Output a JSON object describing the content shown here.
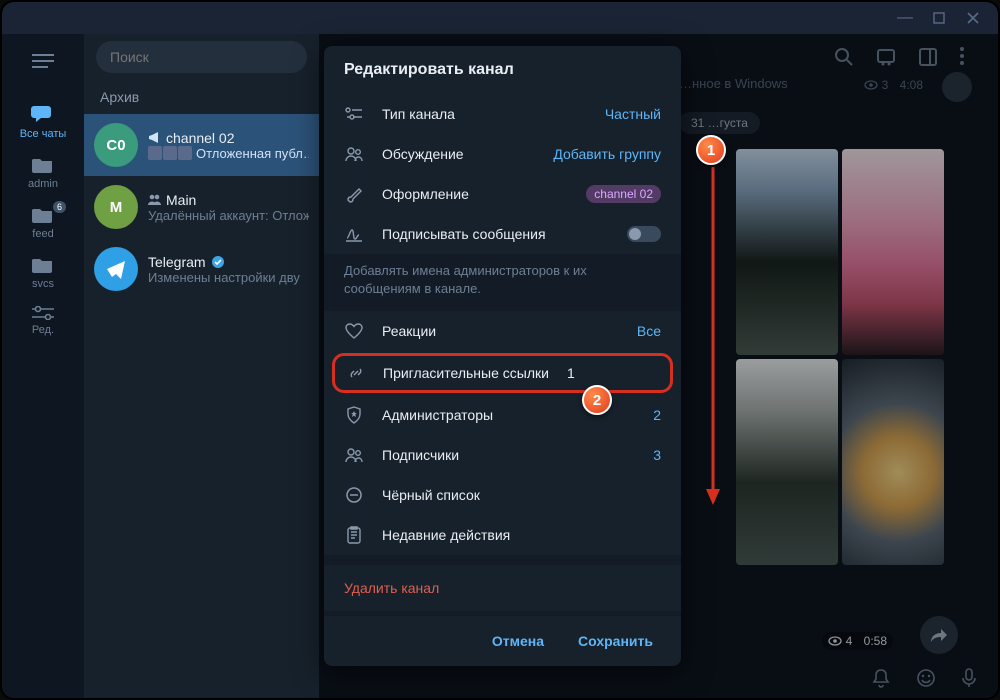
{
  "titlebar": {
    "minimize": "—",
    "maximize": "▢",
    "close": "✕"
  },
  "rail": {
    "items": [
      {
        "label": "Все чаты",
        "active": true
      },
      {
        "label": "admin"
      },
      {
        "label": "feed",
        "badge": "6"
      },
      {
        "label": "svcs"
      },
      {
        "label": "Ред."
      }
    ]
  },
  "search": {
    "placeholder": "Поиск"
  },
  "archive": {
    "label": "Архив"
  },
  "chats": [
    {
      "avatar": "C0",
      "title": "channel 02",
      "sub": "Отложенная публ…",
      "selected": true,
      "megaphone": true
    },
    {
      "avatar": "M",
      "title": "Main",
      "sub": "Удалённый аккаунт: Отлож",
      "people": true
    },
    {
      "avatar": "",
      "title": "Telegram",
      "sub": "Изменены настройки дву",
      "verified": true,
      "tg": true
    }
  ],
  "content": {
    "bgtext": "…нное в Windows",
    "view1_count": "3",
    "view1_time": "4:08",
    "date_chip": "31 …густа",
    "view2_count": "4",
    "view2_time": "0:58"
  },
  "modal": {
    "title": "Редактировать канал",
    "rows_top": [
      {
        "label": "Тип канала",
        "value": "Частный",
        "kind": "link"
      },
      {
        "label": "Обсуждение",
        "value": "Добавить группу",
        "kind": "link"
      },
      {
        "label": "Оформление",
        "value": "channel 02",
        "kind": "chip"
      },
      {
        "label": "Подписывать сообщения",
        "kind": "toggle"
      }
    ],
    "hint": "Добавлять имена администраторов к их сообщениям в канале.",
    "rows_mid": [
      {
        "label": "Реакции",
        "value": "Все",
        "kind": "link"
      }
    ],
    "highlight": {
      "label": "Пригласительные ссылки",
      "value": "1"
    },
    "rows_after": [
      {
        "label": "Администраторы",
        "value": "2",
        "kind": "num"
      },
      {
        "label": "Подписчики",
        "value": "3",
        "kind": "num"
      },
      {
        "label": "Чёрный список",
        "kind": "none"
      },
      {
        "label": "Недавние действия",
        "kind": "none"
      }
    ],
    "delete": "Удалить канал",
    "cancel": "Отмена",
    "save": "Сохранить"
  },
  "markers": {
    "one": "1",
    "two": "2"
  }
}
